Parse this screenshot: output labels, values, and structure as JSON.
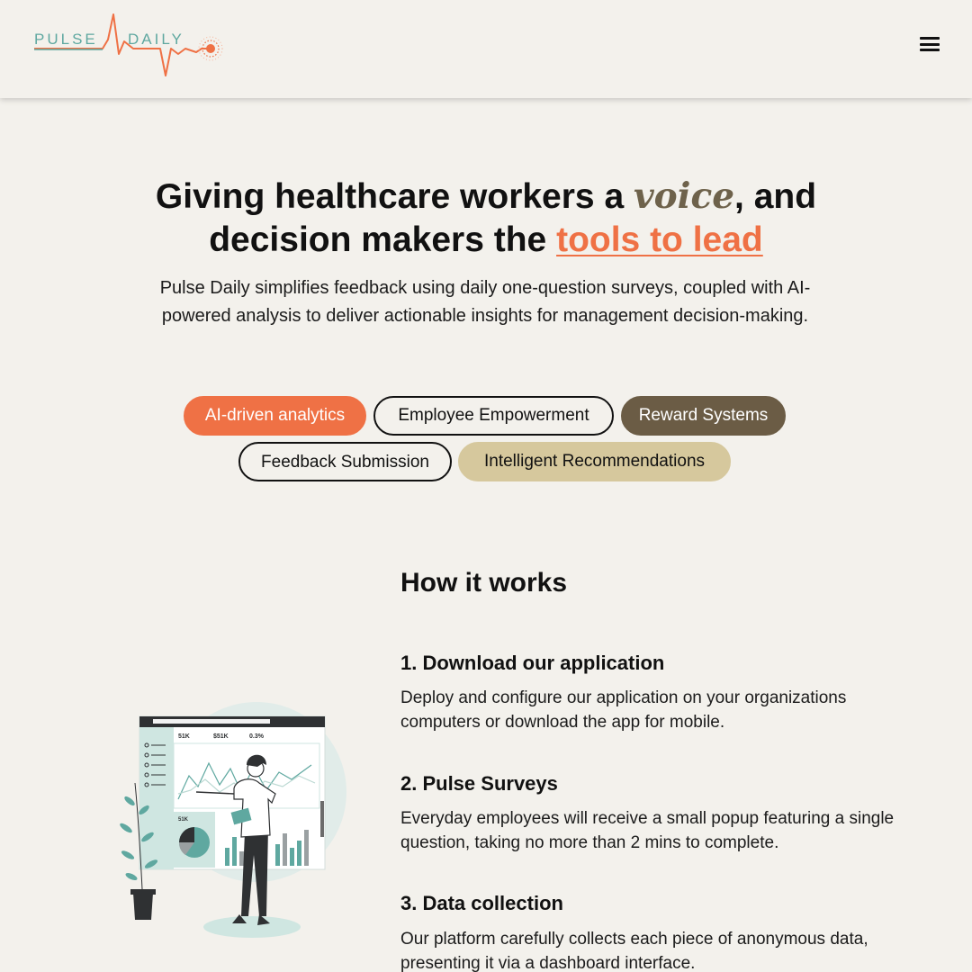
{
  "header": {
    "logo_text_left": "PULSE",
    "logo_text_right": "DAILY",
    "menu_icon": "hamburger-menu-icon"
  },
  "hero": {
    "title_part1": "Giving healthcare workers a ",
    "title_highlight1": "voice",
    "title_part2": ", and decision makers the ",
    "title_highlight2": "tools to lead",
    "subtitle": "Pulse Daily simplifies feedback using daily one-question surveys, coupled with AI-powered analysis to deliver actionable insights for management decision-making."
  },
  "tags": [
    {
      "label": "AI-driven analytics"
    },
    {
      "label": "Employee Empowerment"
    },
    {
      "label": "Reward Systems"
    },
    {
      "label": "Feedback Submission"
    },
    {
      "label": "Intelligent Recommendations"
    }
  ],
  "how_it_works": {
    "title": "How it works",
    "steps": [
      {
        "title": "1. Download our application",
        "text": "Deploy and configure our application on your organizations computers or download the app for mobile."
      },
      {
        "title": "2. Pulse Surveys",
        "text": "Everyday employees will receive a small popup featuring a single question, taking no more than 2 mins to complete."
      },
      {
        "title": "3. Data collection",
        "text": "Our platform carefully collects each piece of anonymous data, presenting it via a dashboard interface."
      }
    ]
  },
  "illustration": {
    "stat_labels": [
      "51K",
      "$51K",
      "0.3%"
    ],
    "card_label": "51K"
  },
  "colors": {
    "background": "#f3f1ec",
    "accent_orange": "#ef7145",
    "brown": "#6b5c45",
    "sand": "#d6c89d",
    "teal": "#5fa8a0"
  }
}
